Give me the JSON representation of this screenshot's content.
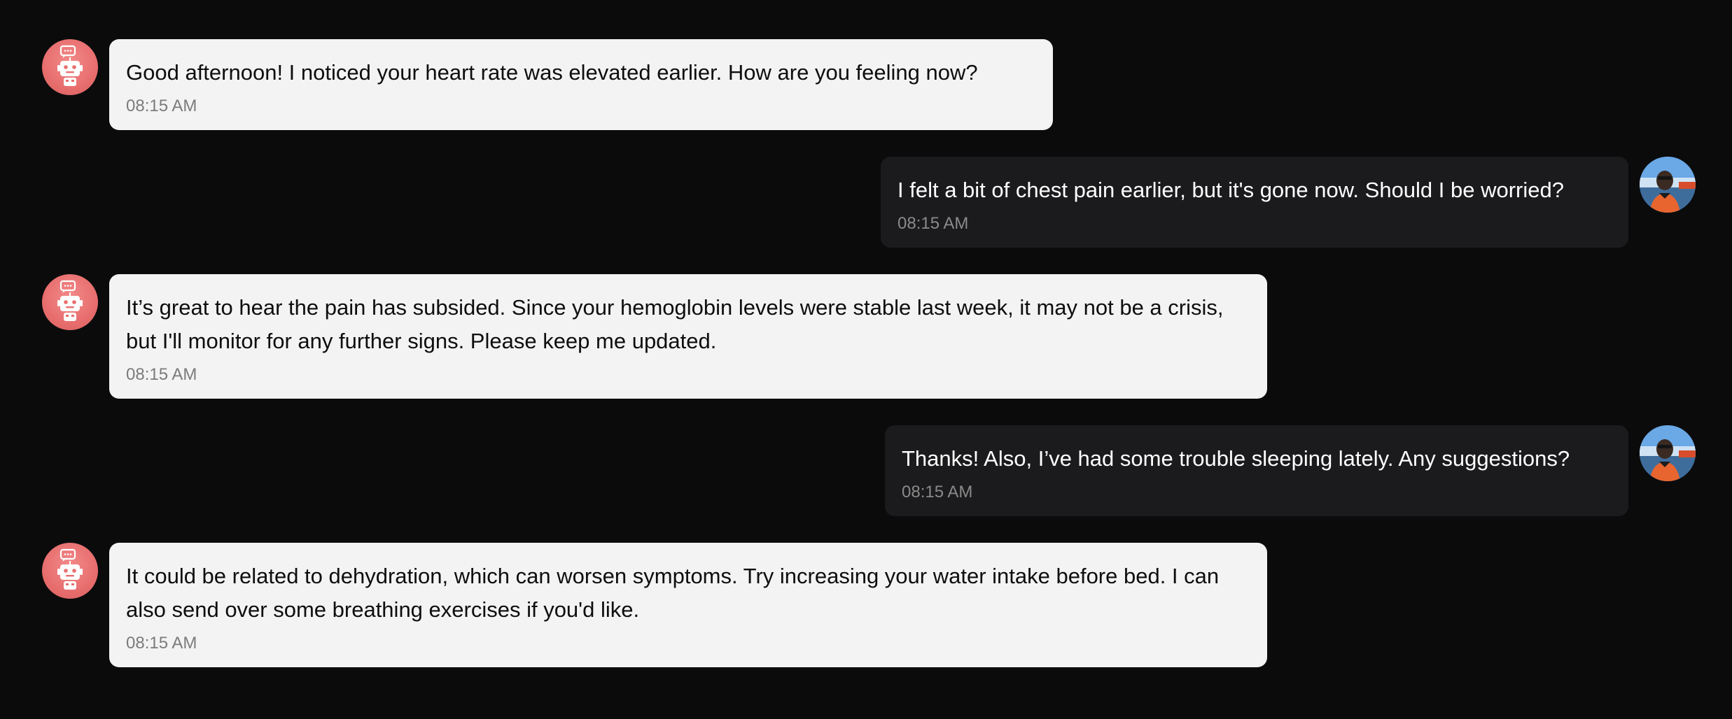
{
  "conversation": {
    "messages": [
      {
        "sender": "assistant",
        "avatar_icon": "robot-icon",
        "text": "Good afternoon! I noticed your heart rate was elevated earlier. How are you feeling now?",
        "time": "08:15 AM"
      },
      {
        "sender": "user",
        "avatar_icon": "user-photo",
        "text": "I felt a bit of chest pain earlier, but it's gone now. Should I be worried?",
        "time": "08:15 AM"
      },
      {
        "sender": "assistant",
        "avatar_icon": "robot-icon",
        "text": "It’s great to hear the pain has subsided. Since your hemoglobin levels were stable last week, it may not be a crisis, but I'll monitor for any further signs. Please keep me updated.",
        "time": "08:15 AM"
      },
      {
        "sender": "user",
        "avatar_icon": "user-photo",
        "text": "Thanks! Also, I’ve had some trouble sleeping lately. Any suggestions?",
        "time": "08:15 AM"
      },
      {
        "sender": "assistant",
        "avatar_icon": "robot-icon",
        "text": "It could be related to dehydration, which can worsen symptoms. Try increasing your water intake before bed. I can also send over some breathing exercises if you'd like.",
        "time": "08:15 AM"
      }
    ]
  },
  "colors": {
    "background": "#0b0b0c",
    "assistant_bubble": "#f3f3f3",
    "user_bubble": "#1b1b1d",
    "assistant_avatar": "#e86e6e"
  }
}
